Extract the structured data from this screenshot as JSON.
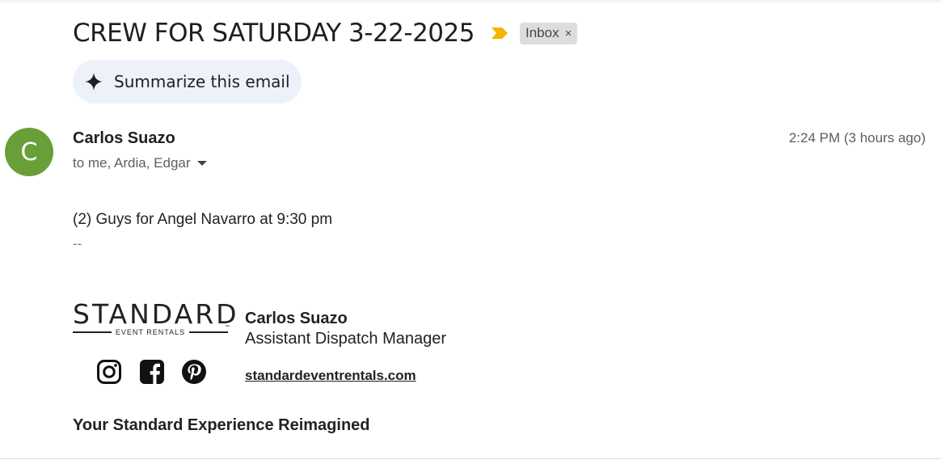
{
  "email": {
    "subject": "CREW FOR SATURDAY 3-22-2025",
    "label": "Inbox",
    "label_remove": "×",
    "importance_color": "#f4b400",
    "summarize_label": "Summarize this email",
    "summarize_icon": "sparkle-icon",
    "sender": {
      "initial": "C",
      "avatar_color": "#689f38",
      "name": "Carlos Suazo",
      "recipients": "to me, Ardia, Edgar",
      "time": "2:24 PM (3 hours ago)"
    },
    "body": "(2) Guys for Angel Navarro at 9:30 pm",
    "separator": "--"
  },
  "signature": {
    "logo_word": "STANDARD",
    "logo_sub": "EVENT RENTALS",
    "logo_tm": "™",
    "name": "Carlos Suazo",
    "title": "Assistant Dispatch Manager",
    "website": "standardeventrentals.com",
    "social_icons": [
      "instagram-icon",
      "facebook-icon",
      "pinterest-icon"
    ],
    "tagline": "Your Standard Experience Reimagined"
  }
}
